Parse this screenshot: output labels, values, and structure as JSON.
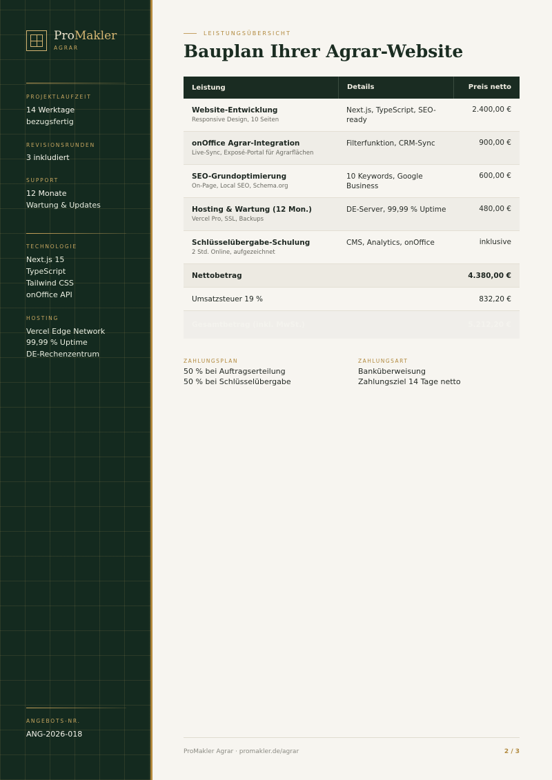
{
  "brand": {
    "name_a": "Pro",
    "name_b": "Makler",
    "sub": "AGRAR"
  },
  "sidebar": {
    "laufzeit_label": "PROJEKTLAUFZEIT",
    "laufzeit_value": "14 Werktage",
    "laufzeit_sub": "bezugsfertig",
    "revision_label": "REVISIONSRUNDEN",
    "revision_value": "3 inkludiert",
    "support_label": "SUPPORT",
    "support_value": "12 Monate",
    "support_sub": "Wartung & Updates",
    "tech_label": "TECHNOLOGIE",
    "tech_items": [
      "Next.js 15",
      "TypeScript",
      "Tailwind CSS",
      "onOffice API"
    ],
    "hosting_label": "HOSTING",
    "hosting_items": [
      "Vercel Edge Network",
      "99,99 % Uptime",
      "DE-Rechenzentrum"
    ],
    "offer_label": "ANGEBOTS-NR.",
    "offer_value": "ANG-2026-018"
  },
  "header": {
    "eyebrow": "LEISTUNGSÜBERSICHT",
    "title": "Bauplan Ihrer Agrar-Website"
  },
  "table": {
    "headers": {
      "leistung": "Leistung",
      "details": "Details",
      "preis": "Preis netto"
    },
    "rows": [
      {
        "name": "Website-Entwicklung",
        "sub": "Responsive Design, 10 Seiten",
        "details": "Next.js, TypeScript, SEO-ready",
        "price": "2.400,00 €"
      },
      {
        "name": "onOffice Agrar-Integration",
        "sub": "Live-Sync, Exposé-Portal für Agrarflächen",
        "details": "Filterfunktion, CRM-Sync",
        "price": "900,00 €"
      },
      {
        "name": "SEO-Grundoptimierung",
        "sub": "On-Page, Local SEO, Schema.org",
        "details": "10 Keywords, Google Business",
        "price": "600,00 €"
      },
      {
        "name": "Hosting & Wartung (12 Mon.)",
        "sub": "Vercel Pro, SSL, Backups",
        "details": "DE-Server, 99,99 % Uptime",
        "price": "480,00 €"
      },
      {
        "name": "Schlüsselübergabe-Schulung",
        "sub": "2 Std. Online, aufgezeichnet",
        "details": "CMS, Analytics, onOffice",
        "price": "inklusive"
      }
    ],
    "net_label": "Nettobetrag",
    "net_value": "4.380,00 €",
    "tax_label": "Umsatzsteuer 19 %",
    "tax_value": "832,20 €",
    "total_label": "Gesamtbetrag (inkl. MwSt.)",
    "total_value": "5.212,20 €"
  },
  "payment": {
    "plan_label": "ZAHLUNGSPLAN",
    "plan_lines": [
      "50 % bei Auftragserteilung",
      "50 % bei Schlüsselübergabe"
    ],
    "method_label": "ZAHLUNGSART",
    "method_lines": [
      "Banküberweisung",
      "Zahlungsziel 14 Tage netto"
    ]
  },
  "footer": {
    "left": "ProMakler Agrar · promakler.de/agrar",
    "page": "2 / 3"
  },
  "colors": {
    "sidebar_bg": "#142a1f",
    "gold": "#b48a3e",
    "header_bg": "#1a2c22",
    "page_bg": "#f7f5f0"
  }
}
